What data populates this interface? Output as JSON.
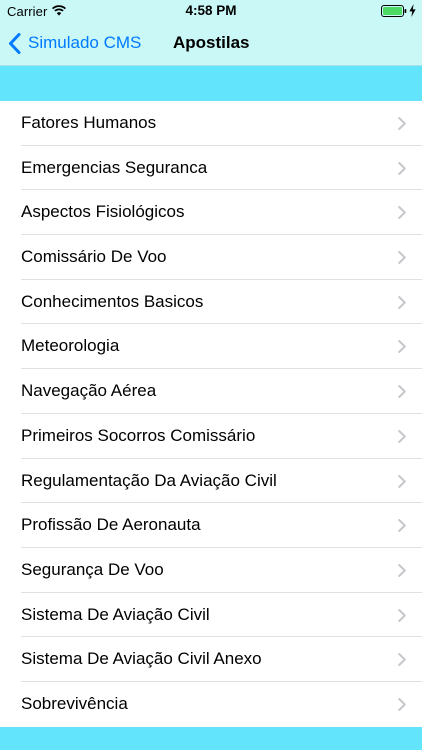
{
  "status_bar": {
    "carrier": "Carrier",
    "time": "4:58 PM",
    "wifi_icon": "wifi-icon",
    "battery_icon": "battery-icon",
    "charging_icon": "bolt-icon"
  },
  "nav": {
    "back_label": "Simulado CMS",
    "back_icon": "chevron-left-icon",
    "title": "Apostilas"
  },
  "colors": {
    "nav_background": "#c9f8f6",
    "section_band": "#62e5fc",
    "accent": "#007aff",
    "separator": "#e0e0e3",
    "chevron": "#c7c7cc"
  },
  "list": {
    "item_icon": "chevron-right-icon",
    "items": [
      {
        "label": "Fatores Humanos"
      },
      {
        "label": "Emergencias Seguranca"
      },
      {
        "label": "Aspectos Fisiológicos"
      },
      {
        "label": "Comissário De Voo"
      },
      {
        "label": "Conhecimentos Basicos"
      },
      {
        "label": "Meteorologia"
      },
      {
        "label": "Navegação Aérea"
      },
      {
        "label": "Primeiros Socorros Comissário"
      },
      {
        "label": "Regulamentação Da Aviação Civil"
      },
      {
        "label": "Profissão De Aeronauta"
      },
      {
        "label": "Segurança De Voo"
      },
      {
        "label": "Sistema De Aviação Civil"
      },
      {
        "label": "Sistema De Aviação Civil Anexo"
      },
      {
        "label": "Sobrevivência"
      }
    ]
  }
}
